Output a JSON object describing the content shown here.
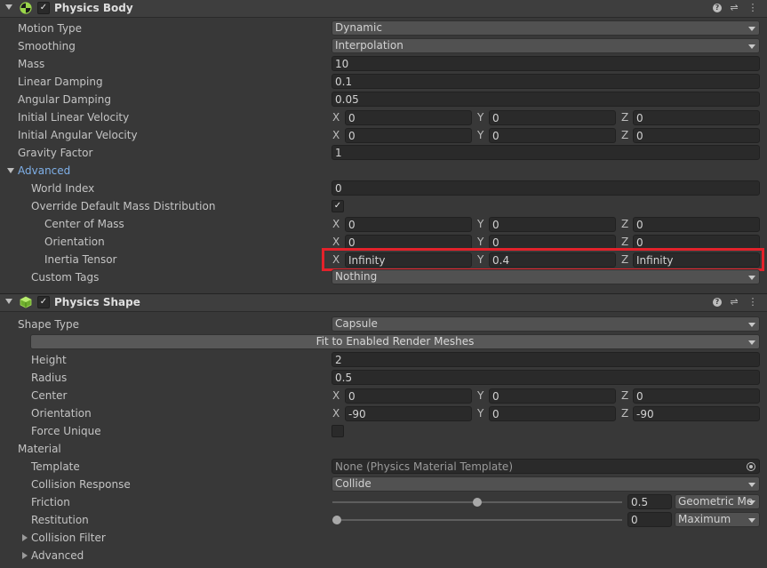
{
  "physics_body": {
    "title": "Physics Body",
    "help_glyph": "?",
    "settings_glyph": "⇌",
    "menu_glyph": "⋮",
    "motion_type": {
      "label": "Motion Type",
      "value": "Dynamic"
    },
    "smoothing": {
      "label": "Smoothing",
      "value": "Interpolation"
    },
    "mass": {
      "label": "Mass",
      "value": "10"
    },
    "linear_damping": {
      "label": "Linear Damping",
      "value": "0.1"
    },
    "angular_damping": {
      "label": "Angular Damping",
      "value": "0.05"
    },
    "initial_linear_velocity": {
      "label": "Initial Linear Velocity",
      "x": "0",
      "y": "0",
      "z": "0"
    },
    "initial_angular_velocity": {
      "label": "Initial Angular Velocity",
      "x": "0",
      "y": "0",
      "z": "0"
    },
    "gravity_factor": {
      "label": "Gravity Factor",
      "value": "1"
    },
    "advanced": {
      "label": "Advanced",
      "world_index": {
        "label": "World Index",
        "value": "0"
      },
      "override_mass": {
        "label": "Override Default Mass Distribution",
        "checked": true
      },
      "center_of_mass": {
        "label": "Center of Mass",
        "x": "0",
        "y": "0",
        "z": "0"
      },
      "orientation": {
        "label": "Orientation",
        "x": "0",
        "y": "0",
        "z": "0"
      },
      "inertia_tensor": {
        "label": "Inertia Tensor",
        "x": "Infinity",
        "y": "0.4",
        "z": "Infinity"
      },
      "custom_tags": {
        "label": "Custom Tags",
        "value": "Nothing"
      }
    }
  },
  "physics_shape": {
    "title": "Physics Shape",
    "shape_type": {
      "label": "Shape Type",
      "value": "Capsule"
    },
    "fit_button": "Fit to Enabled Render Meshes",
    "height": {
      "label": "Height",
      "value": "2"
    },
    "radius": {
      "label": "Radius",
      "value": "0.5"
    },
    "center": {
      "label": "Center",
      "x": "0",
      "y": "0",
      "z": "0"
    },
    "orientation": {
      "label": "Orientation",
      "x": "-90",
      "y": "0",
      "z": "-90"
    },
    "force_unique": {
      "label": "Force Unique",
      "checked": false
    },
    "material": {
      "label": "Material",
      "template": {
        "label": "Template",
        "value": "None (Physics Material Template)"
      },
      "collision_response": {
        "label": "Collision Response",
        "value": "Collide"
      },
      "friction": {
        "label": "Friction",
        "value": "0.5",
        "slider_fraction": 0.5,
        "combine": "Geometric Me"
      },
      "restitution": {
        "label": "Restitution",
        "value": "0",
        "slider_fraction": 0.0,
        "combine": "Maximum"
      },
      "collision_filter": {
        "label": "Collision Filter"
      },
      "advanced": {
        "label": "Advanced"
      }
    }
  },
  "axes": {
    "x": "X",
    "y": "Y",
    "z": "Z"
  },
  "check_glyph": "✓",
  "colors": {
    "background": "#383838",
    "field": "#2a2a2a",
    "highlight": "#e3222b",
    "link": "#7fb0e8",
    "shape_icon": "#8ad13b"
  }
}
